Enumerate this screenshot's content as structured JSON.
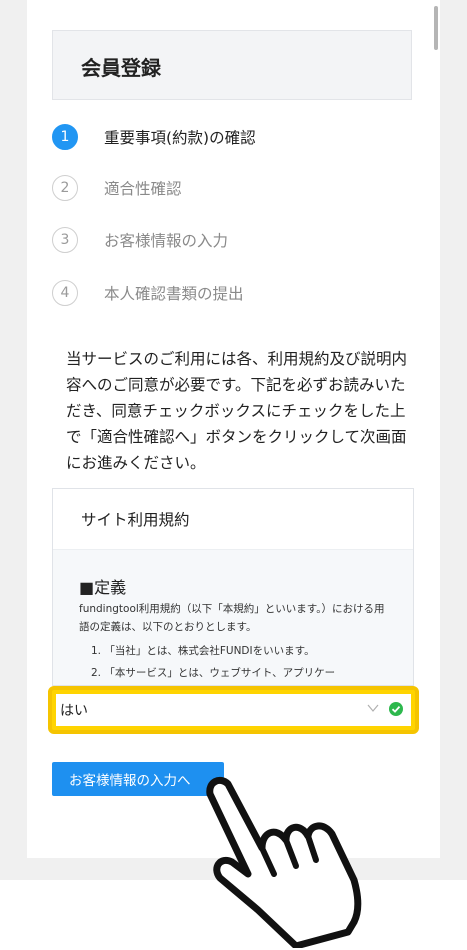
{
  "page": {
    "title": "会員登録"
  },
  "steps": [
    {
      "num": "1",
      "label": "重要事項(約款)の確認",
      "active": true
    },
    {
      "num": "2",
      "label": "適合性確認",
      "active": false
    },
    {
      "num": "3",
      "label": "お客様情報の入力",
      "active": false
    },
    {
      "num": "4",
      "label": "本人確認書類の提出",
      "active": false
    }
  ],
  "intro": "当サービスのご利用には各、利用規約及び説明内容へのご同意が必要です。下記を必ずお読みいただき、同意チェックボックスにチェックをした上で「適合性確認へ」ボタンをクリックして次画面にお進みください。",
  "terms": {
    "heading": "サイト利用規約",
    "section_title": "■定義",
    "text": "fundingtool利用規約（以下「本規約」といいます。）における用語の定義は、以下のとおりとします。",
    "items": [
      "1. 「当社」とは、株式会社FUNDIをいいます。",
      "2. 「本サービス」とは、ウェブサイト、アプリケー"
    ]
  },
  "agreement_select": {
    "value": "はい",
    "status": "valid"
  },
  "next_button": {
    "label": "お客様情報の入力へ"
  },
  "icons": {
    "select_arrow": "chevron-down-icon",
    "valid": "check-circle-icon",
    "pointer": "pointing-hand-icon"
  },
  "colors": {
    "accent": "#2196f3",
    "button": "#1e90f0",
    "highlight": "#f5c400",
    "success": "#2db84d"
  }
}
